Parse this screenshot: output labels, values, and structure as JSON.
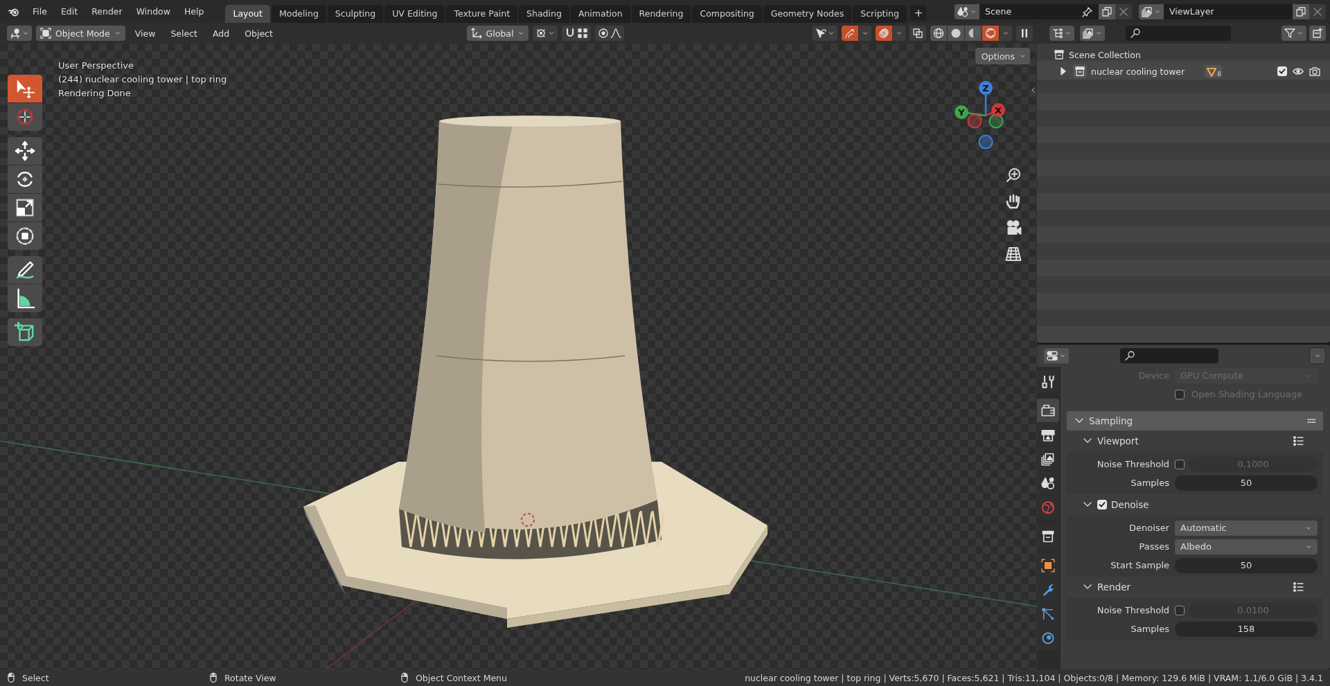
{
  "top_bar": {
    "menus": [
      "File",
      "Edit",
      "Render",
      "Window",
      "Help"
    ],
    "workspaces": [
      {
        "label": "Layout",
        "selected": true
      },
      {
        "label": "Modeling",
        "selected": false
      },
      {
        "label": "Sculpting",
        "selected": false
      },
      {
        "label": "UV Editing",
        "selected": false
      },
      {
        "label": "Texture Paint",
        "selected": false
      },
      {
        "label": "Shading",
        "selected": false
      },
      {
        "label": "Animation",
        "selected": false
      },
      {
        "label": "Rendering",
        "selected": false
      },
      {
        "label": "Compositing",
        "selected": false
      },
      {
        "label": "Geometry Nodes",
        "selected": false
      },
      {
        "label": "Scripting",
        "selected": false
      }
    ],
    "add_workspace": "+",
    "scene": "Scene",
    "view_layer": "ViewLayer"
  },
  "viewport": {
    "header": {
      "mode": "Object Mode",
      "menus": [
        "View",
        "Select",
        "Add",
        "Object"
      ],
      "orientation": "Global",
      "left_toggles": [
        {
          "kind": "snap",
          "on": false
        },
        {
          "kind": "proportional",
          "on": false
        }
      ],
      "right_toggles": [
        {
          "kind": "gizmos",
          "on": true
        },
        {
          "kind": "overlays",
          "on": true
        },
        {
          "kind": "xray",
          "on": false
        }
      ],
      "shading": [
        {
          "kind": "wireframe",
          "selected": false
        },
        {
          "kind": "solid",
          "selected": false
        },
        {
          "kind": "material",
          "selected": false
        },
        {
          "kind": "rendered",
          "selected": true
        }
      ]
    },
    "tool_groups": [
      {
        "tools": [
          {
            "kind": "select_box",
            "selected": true
          },
          {
            "kind": "cursor",
            "selected": false
          }
        ]
      },
      {
        "tools": [
          {
            "kind": "move",
            "selected": false
          },
          {
            "kind": "rotate",
            "selected": false
          },
          {
            "kind": "scale",
            "selected": false
          },
          {
            "kind": "transform",
            "selected": false
          }
        ]
      },
      {
        "tools": [
          {
            "kind": "annotate",
            "selected": false
          },
          {
            "kind": "measure",
            "selected": false
          }
        ]
      },
      {
        "tools": [
          {
            "kind": "add_cube",
            "selected": false
          }
        ]
      }
    ],
    "overlay_text": [
      "User Perspective",
      "(244) nuclear cooling tower | top ring",
      "Rendering Done"
    ],
    "options": "Options",
    "gizmo_axes": [
      {
        "label": "Z",
        "color": "#3d7fe0"
      },
      {
        "label": "Y",
        "color": "#3fa54a"
      },
      {
        "label": "X",
        "color": "#c93b3b"
      }
    ]
  },
  "outliner": {
    "rows": [
      {
        "kind": "scene_collection",
        "label": "Scene Collection"
      },
      {
        "kind": "collection",
        "label": "nuclear cooling tower",
        "expanded": false,
        "badge": "8",
        "checked": true
      }
    ]
  },
  "properties": {
    "tab_groups": [
      {
        "tabs": [
          {
            "kind": "tool",
            "selected": false
          }
        ]
      },
      {
        "tabs": [
          {
            "kind": "render",
            "selected": true
          },
          {
            "kind": "output",
            "selected": false
          },
          {
            "kind": "view_layer",
            "selected": false
          },
          {
            "kind": "scene",
            "selected": false
          },
          {
            "kind": "world",
            "selected": false
          }
        ]
      },
      {
        "tabs": [
          {
            "kind": "collection",
            "selected": false
          }
        ]
      },
      {
        "tabs": [
          {
            "kind": "object",
            "selected": false
          },
          {
            "kind": "modifiers",
            "selected": false
          },
          {
            "kind": "particles",
            "selected": false
          },
          {
            "kind": "physics",
            "selected": false
          }
        ]
      }
    ],
    "top_rows": [
      {
        "kind": "dropdown",
        "label": "Device",
        "value": "GPU Compute",
        "disabled": true
      },
      {
        "kind": "checkbox",
        "label": "Open Shading Language",
        "checked": false,
        "disabled": true
      }
    ],
    "panel": {
      "label": "Sampling",
      "expanded": true,
      "subpanels": [
        {
          "label": "Viewport",
          "expanded": true,
          "rows": [
            {
              "kind": "toggle_number",
              "label": "Noise Threshold",
              "checked": false,
              "value": "0.1000"
            },
            {
              "kind": "number",
              "label": "Samples",
              "value": "50"
            }
          ]
        },
        {
          "label": "Denoise",
          "expanded": true,
          "checked": true,
          "rows": [
            {
              "kind": "dropdown",
              "label": "Denoiser",
              "value": "Automatic"
            },
            {
              "kind": "dropdown",
              "label": "Passes",
              "value": "Albedo"
            },
            {
              "kind": "number",
              "label": "Start Sample",
              "value": "50"
            }
          ]
        },
        {
          "label": "Render",
          "expanded": true,
          "rows": [
            {
              "kind": "toggle_number",
              "label": "Noise Threshold",
              "checked": false,
              "value": "0.0100"
            },
            {
              "kind": "number",
              "label": "Samples",
              "value": "158"
            }
          ]
        }
      ]
    }
  },
  "status_bar": {
    "hints": [
      {
        "kind": "left_click",
        "label": "Select"
      },
      {
        "kind": "middle_click",
        "label": "Rotate View"
      },
      {
        "kind": "right_click",
        "label": "Object Context Menu"
      }
    ],
    "stats": "nuclear cooling tower | top ring | Verts:5,670 | Faces:5,621 | Tris:11,104 | Objects:0/8 | Memory: 129.6 MiB | VRAM: 1.1/6.0 GiB | 3.4.1"
  }
}
